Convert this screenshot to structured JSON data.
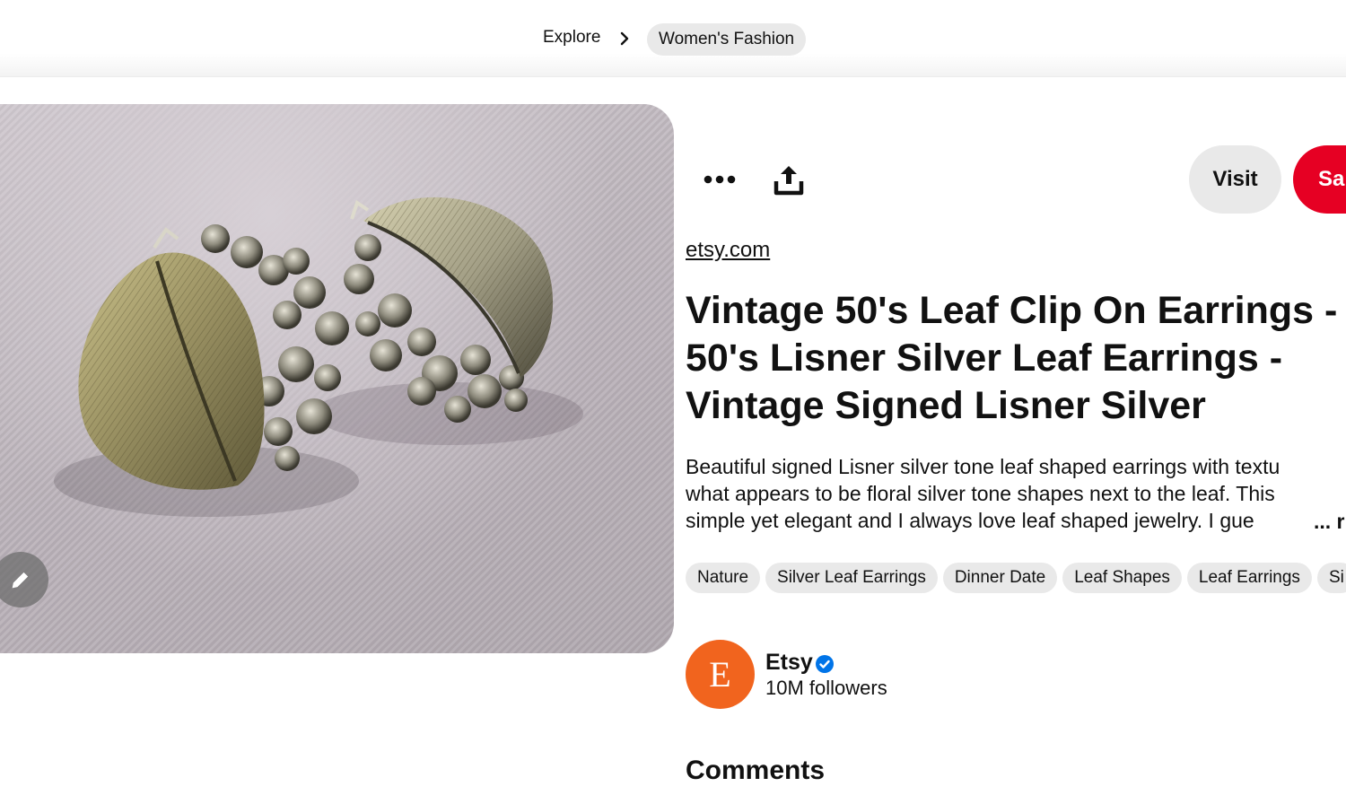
{
  "breadcrumb": {
    "explore_label": "Explore",
    "category_label": "Women's Fashion"
  },
  "actions": {
    "more_icon": "ellipsis-icon",
    "share_icon": "upload-share-icon",
    "visit_label": "Visit",
    "save_label": "Sa"
  },
  "pin": {
    "source": "etsy.com",
    "title": "Vintage 50's Leaf Clip On Earrings - 50's Lisner Silver Leaf Earrings - Vintage Signed Lisner Silver",
    "description_lines": [
      "Beautiful signed Lisner silver tone leaf shaped earrings with textu",
      "what appears to be floral silver tone shapes next to the leaf. This",
      "simple yet elegant and I always love leaf shaped jewelry. I gue"
    ],
    "more_label": "... r",
    "tags": [
      "Nature",
      "Silver Leaf Earrings",
      "Dinner Date",
      "Leaf Shapes",
      "Leaf Earrings",
      "Si"
    ]
  },
  "creator": {
    "avatar_letter": "E",
    "name": "Etsy",
    "followers": "10M followers",
    "avatar_color": "#f1641e",
    "verified_color": "#0074e8"
  },
  "comments": {
    "heading": "Comments"
  },
  "colors": {
    "save_red": "#e60023",
    "pill_gray": "#e9e9e9"
  }
}
